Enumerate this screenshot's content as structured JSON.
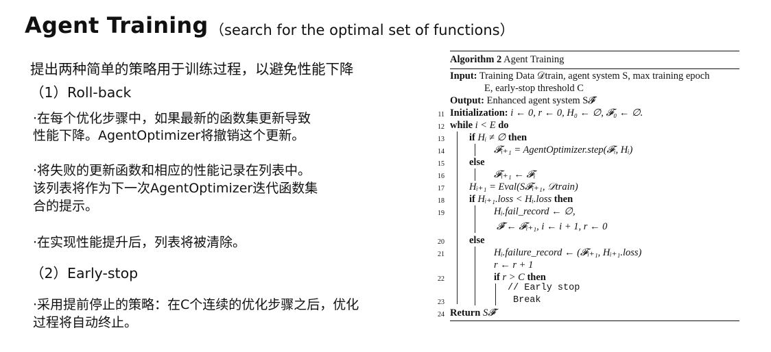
{
  "header": {
    "title": "Agent Training",
    "subtitle": "（search for the optimal set of functions）"
  },
  "left": {
    "intro": "提出两种简单的策略用于训练过程，以避免性能下降",
    "rollback_heading": "（1）Roll-back",
    "rb_p1_l1": "·在每个优化步骤中，如果最新的函数集更新导致",
    "rb_p1_l2": "性能下降。AgentOptimizer将撤销这个更新。",
    "rb_p2_l1": "·将失败的更新函数和相应的性能记录在列表中。",
    "rb_p2_l2": "该列表将作为下一次AgentOptimizer迭代函数集",
    "rb_p2_l3": "合的提示。",
    "rb_p3": "·在实现性能提升后，列表将被清除。",
    "earlystop_heading": "（2）Early-stop",
    "es_p1_l1": "·采用提前停止的策略：在C个连续的优化步骤之后，优化",
    "es_p1_l2": "过程将自动终止。"
  },
  "algorithm": {
    "caption_label": "Algorithm 2",
    "caption_text": "Agent Training",
    "input_label": "Input:",
    "input_l1": "Training Data 𝒟train, agent system S, max training epoch",
    "input_l2": "E, early-stop threshold C",
    "output_label": "Output:",
    "output_text": "Enhanced agent system S𝓕̂",
    "lines": [
      {
        "n": "11",
        "kw": "Initialization:",
        "text": "i ← 0, r ← 0, H₀ ← ∅, 𝓕₀ ← ∅."
      },
      {
        "n": "12",
        "kw": "while",
        "text": "i < E",
        "kw2": "do"
      },
      {
        "n": "13",
        "kw": "if",
        "text": "Hᵢ ≠ ∅",
        "kw2": "then"
      },
      {
        "n": "14",
        "text": "𝓕ᵢ₊₁ = AgentOptimizer.step(𝓕ᵢ, Hᵢ)"
      },
      {
        "n": "15",
        "kw": "else"
      },
      {
        "n": "16",
        "text": "𝓕ᵢ₊₁ ← 𝓕ᵢ"
      },
      {
        "n": "17",
        "text": "Hᵢ₊₁ = Eval(S𝓕ᵢ₊₁, 𝒟train)"
      },
      {
        "n": "18",
        "kw": "if",
        "text": "Hᵢ₊₁.loss < Hᵢ.loss",
        "kw2": "then"
      },
      {
        "n": "19",
        "text": "Hᵢ.fail_record ← ∅,"
      },
      {
        "n": "",
        "text": "𝓕̂ ← 𝓕ᵢ₊₁, i ← i + 1, r ← 0"
      },
      {
        "n": "20",
        "kw": "else"
      },
      {
        "n": "21",
        "text": "Hᵢ.failure_record ← (𝓕ᵢ₊₁, Hᵢ₊₁.loss)"
      },
      {
        "n": "",
        "text": "r ← r + 1"
      },
      {
        "n": "22",
        "kw": "if",
        "text": "r > C",
        "kw2": "then"
      },
      {
        "n": "",
        "text": "// Early stop"
      },
      {
        "n": "23",
        "text": "Break"
      },
      {
        "n": "24",
        "kw": "Return",
        "text": "S𝓕̂"
      }
    ]
  }
}
